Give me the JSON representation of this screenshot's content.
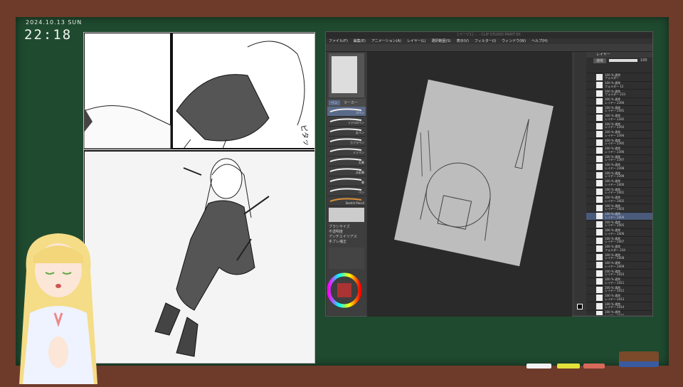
{
  "overlay": {
    "date": "2024.10.13 SUN",
    "time": "22:18"
  },
  "manga": {
    "sfx": "ピタッ"
  },
  "csp": {
    "title": "[ページ1] ... - CLIP STUDIO PAINT EX",
    "menu": [
      "ファイル(F)",
      "編集(E)",
      "アニメーション(A)",
      "レイヤー(L)",
      "選択範囲(S)",
      "表示(V)",
      "フィルター(I)",
      "ウィンドウ(W)",
      "ヘルプ(H)"
    ],
    "brush_tabs": [
      "ペン",
      "マーカー"
    ],
    "brushes": [
      "Gペン",
      "リアルGペン",
      "丸ペン",
      "カブラペン",
      "ミリペン",
      "丸筆",
      "水彩筆",
      "筆",
      "ペン",
      "Sketch Pencil"
    ],
    "tool_props": [
      "ブラシサイズ",
      "不透明度",
      "アンチエイリアス",
      "手ブレ補正"
    ],
    "layers_tab": "レイヤー",
    "blend_mode": "通常",
    "opacity": "100",
    "layers": [
      {
        "line1": "100 % 通常",
        "line2": "フォルダー"
      },
      {
        "line1": "100 % 通常",
        "line2": "フォルダー 12"
      },
      {
        "line1": "100 % 通常",
        "line2": "フォルダー 233"
      },
      {
        "line1": "100 % 通常",
        "line2": "レイヤー 2390"
      },
      {
        "line1": "100 % 通常",
        "line2": "レイヤー 2391"
      },
      {
        "line1": "100 % 通常",
        "line2": "レイヤー 2392"
      },
      {
        "line1": "100 % 通常",
        "line2": "レイヤー 2393"
      },
      {
        "line1": "100 % 通常",
        "line2": "レイヤー 2394"
      },
      {
        "line1": "100 % 通常",
        "line2": "レイヤー 2395"
      },
      {
        "line1": "100 % 通常",
        "line2": "レイヤー 2396"
      },
      {
        "line1": "100 % 通常",
        "line2": "レイヤー 2397"
      },
      {
        "line1": "100 % 通常",
        "line2": "レイヤー 2398"
      },
      {
        "line1": "100 % 通常",
        "line2": "レイヤー 2399"
      },
      {
        "line1": "100 % 通常",
        "line2": "レイヤー 2400"
      },
      {
        "line1": "100 % 通常",
        "line2": "レイヤー 2401"
      },
      {
        "line1": "100 % 通常",
        "line2": "レイヤー 2402"
      },
      {
        "line1": "100 % 通常",
        "line2": "レイヤー 2403"
      },
      {
        "line1": "100 % 通常",
        "line2": "レイヤー 2404",
        "selected": true
      },
      {
        "line1": "100 % 通常",
        "line2": "レイヤー 2405"
      },
      {
        "line1": "100 % 通常",
        "line2": "レイヤー 2406"
      },
      {
        "line1": "100 % 通常",
        "line2": "レイヤー 2407"
      },
      {
        "line1": "100 % 通常",
        "line2": "フォルダー 234"
      },
      {
        "line1": "100 % 通常",
        "line2": "レイヤー 2408"
      },
      {
        "line1": "100 % 通常",
        "line2": "レイヤー 2409"
      },
      {
        "line1": "100 % 通常",
        "line2": "レイヤー 2410"
      },
      {
        "line1": "100 % 通常",
        "line2": "レイヤー 2411"
      },
      {
        "line1": "100 % 通常",
        "line2": "レイヤー 2412"
      },
      {
        "line1": "100 % 通常",
        "line2": "レイヤー 2413"
      },
      {
        "line1": "100 % 通常",
        "line2": "レイヤー 2414"
      },
      {
        "line1": "100 % 通常",
        "line2": "レイヤー 2415"
      }
    ]
  },
  "colors": {
    "board": "#1f4a2f",
    "frame": "#6e3b2b",
    "csp_bg": "#3a3a3a",
    "selected_layer": "#4a5a7a",
    "layer_color_red": "#e84a4a"
  }
}
